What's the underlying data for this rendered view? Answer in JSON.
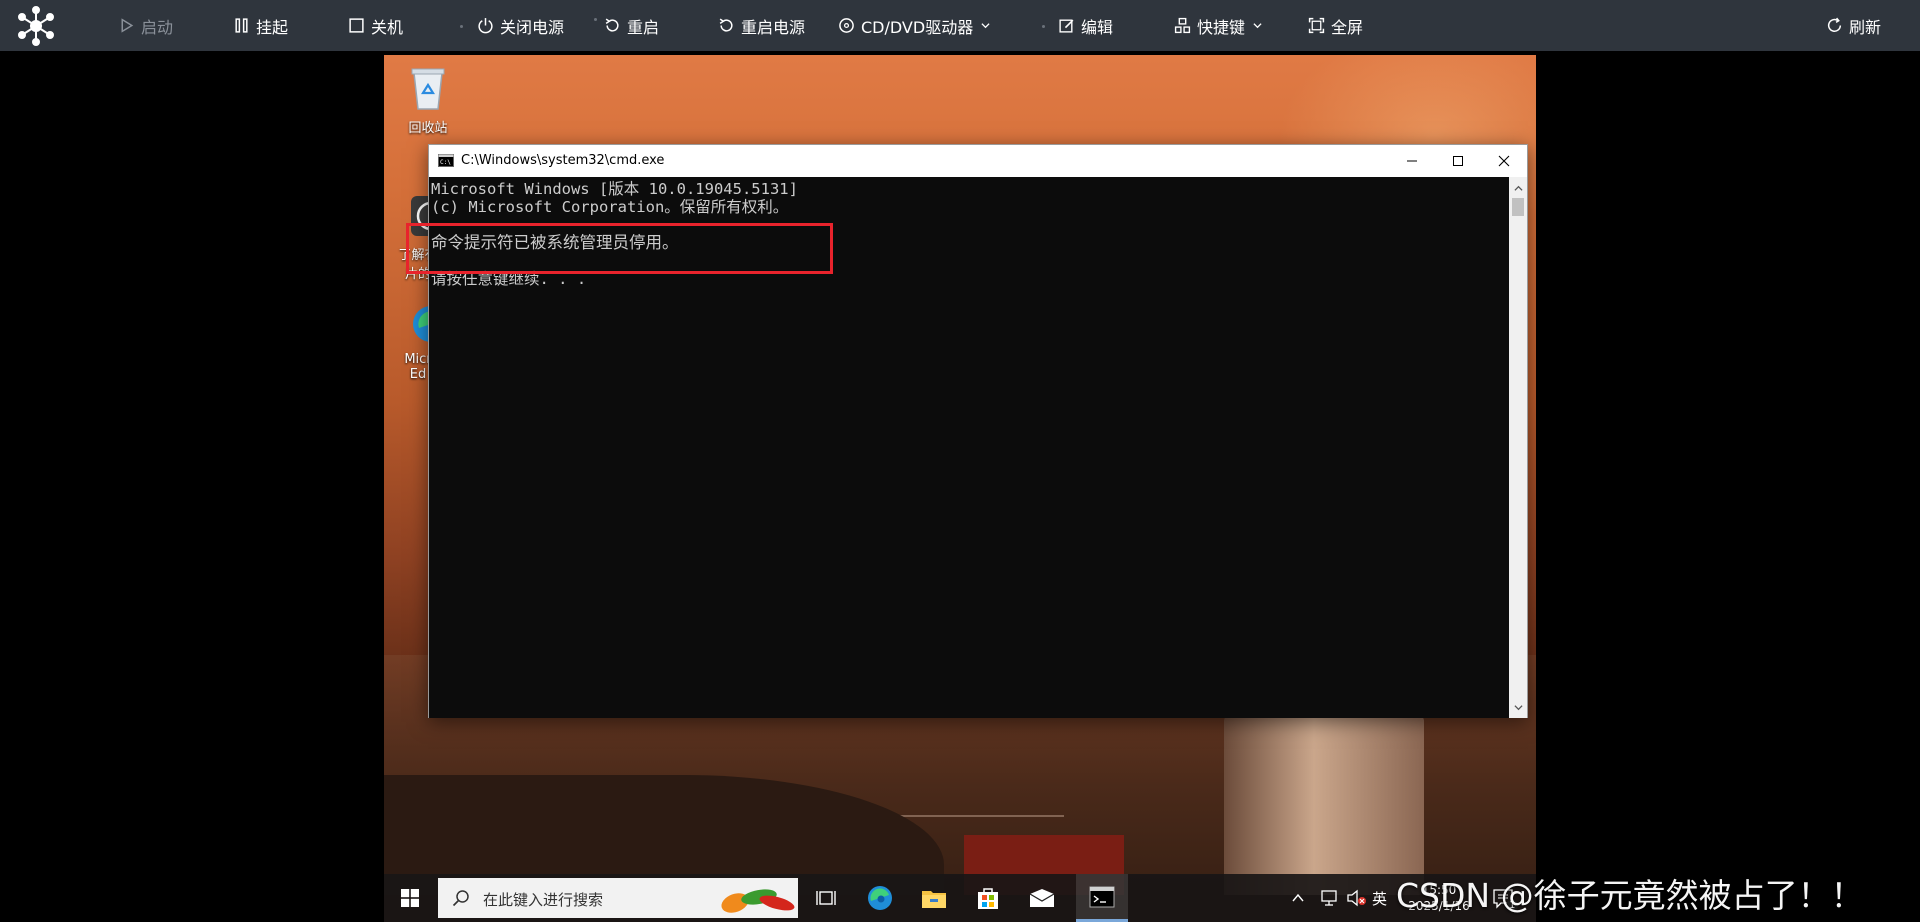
{
  "toolbar": {
    "items": [
      {
        "label": "启动",
        "icon": "play-icon",
        "disabled": true
      },
      {
        "label": "挂起",
        "icon": "pause-icon"
      },
      {
        "label": "关机",
        "icon": "square-icon"
      },
      {
        "label": "关闭电源",
        "icon": "power-icon"
      },
      {
        "label": "重启",
        "icon": "restart-icon"
      },
      {
        "label": "重启电源",
        "icon": "power-cycle-icon"
      },
      {
        "label": "CD/DVD驱动器",
        "icon": "disc-icon",
        "dropdown": true
      },
      {
        "label": "编辑",
        "icon": "edit-icon"
      },
      {
        "label": "快捷键",
        "icon": "shortcut-icon",
        "dropdown": true
      },
      {
        "label": "全屏",
        "icon": "fullscreen-icon"
      }
    ],
    "refresh_label": "刷新"
  },
  "desktop": {
    "icons": [
      {
        "label": "回收站",
        "icon": "recycle-bin-icon"
      },
      {
        "label": "了解有\n片的",
        "icon": "learn-about-picture-icon"
      },
      {
        "label": "Micr\nEd",
        "icon": "edge-icon"
      }
    ]
  },
  "cmd_window": {
    "title": "C:\\Windows\\system32\\cmd.exe",
    "lines": [
      "Microsoft Windows [版本 10.0.19045.5131]",
      "(c) Microsoft Corporation。保留所有权利。",
      "",
      "命令提示符已被系统管理员停用。",
      "",
      "请按任意键继续. . ."
    ]
  },
  "taskbar": {
    "search_placeholder": "在此键入进行搜索",
    "apps": [
      {
        "name": "task-view-icon"
      },
      {
        "name": "edge-icon"
      },
      {
        "name": "file-explorer-icon"
      },
      {
        "name": "microsoft-store-icon"
      },
      {
        "name": "mail-icon"
      },
      {
        "name": "cmd-icon",
        "active": true
      }
    ],
    "ime_label": "英",
    "time": "15:50",
    "date": "2025/1/16",
    "notification_count": "1"
  },
  "watermark": "CSDN @徐子元竟然被占了！！",
  "colors": {
    "toolbar_bg": "#2f353d",
    "highlight_border": "#e8232c",
    "cmd_bg": "#0c0c0c",
    "cmd_text": "#cccccc"
  }
}
